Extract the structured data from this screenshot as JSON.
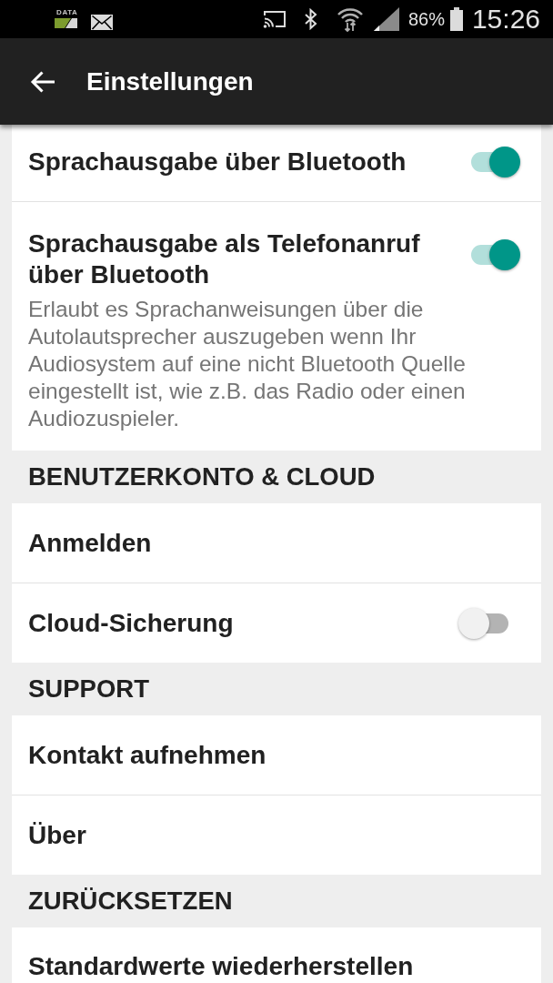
{
  "status_bar": {
    "data_label": "DATA",
    "battery_percent": "86%",
    "time": "15:26"
  },
  "app_bar": {
    "title": "Einstellungen"
  },
  "sections": [
    {
      "items": [
        {
          "kind": "toggle",
          "title": "Sprachausgabe über Bluetooth",
          "on": true
        },
        {
          "kind": "toggle",
          "title": "Sprachausgabe als Telefonanruf über Bluetooth",
          "description": "Erlaubt es Sprachanweisungen über die Autolautsprecher auszugeben wenn Ihr Audiosystem auf eine nicht Bluetooth Quelle eingestellt ist, wie z.B. das Radio oder einen Audiozuspieler.",
          "on": true
        }
      ]
    },
    {
      "header": "BENUTZERKONTO & CLOUD",
      "items": [
        {
          "kind": "link",
          "title": "Anmelden"
        },
        {
          "kind": "toggle",
          "title": "Cloud-Sicherung",
          "on": false
        }
      ]
    },
    {
      "header": "SUPPORT",
      "items": [
        {
          "kind": "link",
          "title": "Kontakt aufnehmen"
        },
        {
          "kind": "link",
          "title": "Über"
        }
      ]
    },
    {
      "header": "ZURÜCKSETZEN",
      "items": [
        {
          "kind": "link",
          "title": "Standardwerte wiederherstellen"
        }
      ]
    }
  ]
}
